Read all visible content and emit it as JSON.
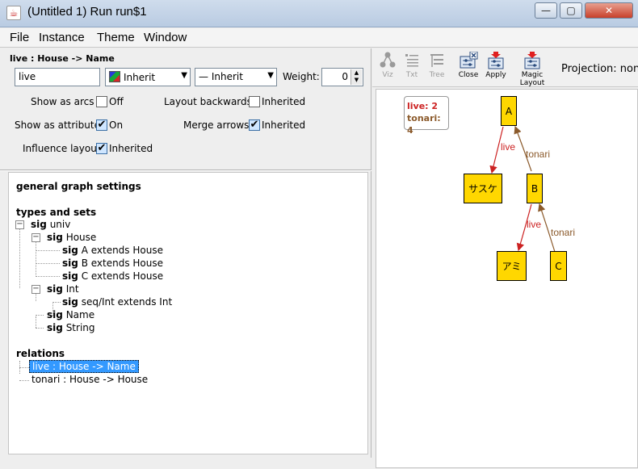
{
  "window": {
    "title": "(Untitled 1) Run run$1",
    "controls": {
      "minimize": "—",
      "maximize": "▢",
      "close": "✕"
    }
  },
  "menu": [
    "File",
    "Instance",
    "Theme",
    "Window"
  ],
  "settings": {
    "header": "live : House -> Name",
    "label_value": "live",
    "color_value": "Inherit",
    "style_value": "— Inherit",
    "weight_label": "Weight:",
    "weight_value": "0",
    "show_as_arcs": {
      "label": "Show as arcs",
      "value": "Off",
      "checked": false
    },
    "layout_backwards": {
      "label": "Layout backwards",
      "value": "Inherited",
      "checked": false
    },
    "show_as_attribute": {
      "label": "Show as attribute",
      "value": "On",
      "checked": true
    },
    "merge_arrows": {
      "label": "Merge arrows",
      "value": "Inherited",
      "checked": true
    },
    "influence_layout": {
      "label": "Influence layout",
      "value": "Inherited",
      "checked": true
    }
  },
  "tree": {
    "general": "general graph settings",
    "types_title": "types and sets",
    "sig_keyword": "sig",
    "univ": "univ",
    "house": "House",
    "a": "A extends House",
    "b": "B extends House",
    "c": "C extends House",
    "int": "Int",
    "seqint": "seq/Int extends Int",
    "name": "Name",
    "string": "String",
    "relations_title": "relations",
    "rel_live": "live :  House -> Name",
    "rel_tonari": "tonari :  House -> House"
  },
  "toolbar": {
    "viz": "Viz",
    "txt": "Txt",
    "tree": "Tree",
    "close": "Close",
    "apply": "Apply",
    "magic": "Magic Layout",
    "projection": "Projection: none"
  },
  "graph": {
    "legend": {
      "live": "live: 2",
      "tonari": "tonari: 4"
    },
    "nodes": {
      "a": "A",
      "b": "B",
      "c": "C",
      "sasuke": "サスケ",
      "ami": "アミ"
    },
    "edges": {
      "live": "live",
      "tonari": "tonari"
    }
  },
  "colors": {
    "node_fill": "#ffd700",
    "live_edge": "#cc2222",
    "tonari_edge": "#8b5a2b",
    "selection": "#3399ff"
  }
}
